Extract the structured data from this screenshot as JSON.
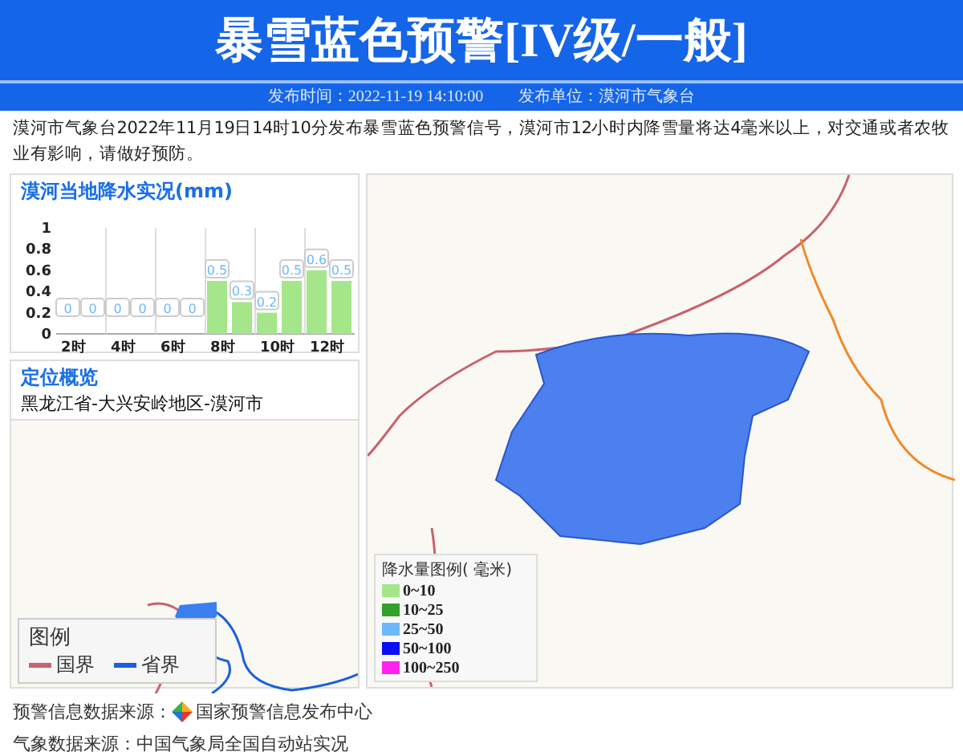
{
  "header": {
    "title": "暴雪蓝色预警[IV级/一般]",
    "publish_time": "发布时间：2022-11-19 14:10:00",
    "publisher": "发布单位：漠河市气象台"
  },
  "description": "漠河市气象台2022年11月19日14时10分发布暴雪蓝色预警信号，漠河市12小时内降雪量将达4毫米以上，对交通或者农牧业有影响，请做好预防。",
  "precip_panel": {
    "title": "漠河当地降水实况(mm)",
    "chart_data": {
      "type": "bar",
      "categories": [
        "2时",
        null,
        "4时",
        null,
        "6时",
        null,
        "8时",
        null,
        "10时",
        null,
        "12时",
        null
      ],
      "series": [
        {
          "color": "#a6e68a",
          "values": [
            0,
            0,
            0,
            0,
            0,
            0,
            0.5,
            0.3,
            0.2,
            0.5,
            0.6,
            0.5
          ]
        }
      ],
      "ylim": [
        0,
        1
      ],
      "yticks": [
        {
          "value": 0,
          "label": "0"
        },
        {
          "value": 0.2,
          "label": "0.2"
        },
        {
          "value": 0.4,
          "label": "0.4"
        },
        {
          "value": 0.6,
          "label": "0.6"
        },
        {
          "value": 0.8,
          "label": "0.8"
        },
        {
          "value": 1,
          "label": "1"
        }
      ],
      "data_labels": true
    }
  },
  "location_panel": {
    "title": "定位概览",
    "path": "黑龙江省-大兴安岭地区-漠河市",
    "legend": {
      "title": "图例",
      "items": [
        {
          "label": "国界",
          "color": "#c8636f"
        },
        {
          "label": "省界",
          "color": "#1a5fe0"
        }
      ]
    }
  },
  "map_legend": {
    "title": "降水量图例( 毫米)",
    "items": [
      {
        "label": "0~10",
        "color": "#a6e68a"
      },
      {
        "label": "10~25",
        "color": "#33a02c"
      },
      {
        "label": "25~50",
        "color": "#6cb8ff"
      },
      {
        "label": "50~100",
        "color": "#0a10f0"
      },
      {
        "label": "100~250",
        "color": "#ff22ee"
      }
    ]
  },
  "footer": [
    {
      "label": "预警信息数据来源：",
      "source": "国家预警信息发布中心",
      "logo": true
    },
    {
      "label": "气象数据来源：",
      "source": "中国气象局全国自动站实况",
      "logo": false
    }
  ]
}
